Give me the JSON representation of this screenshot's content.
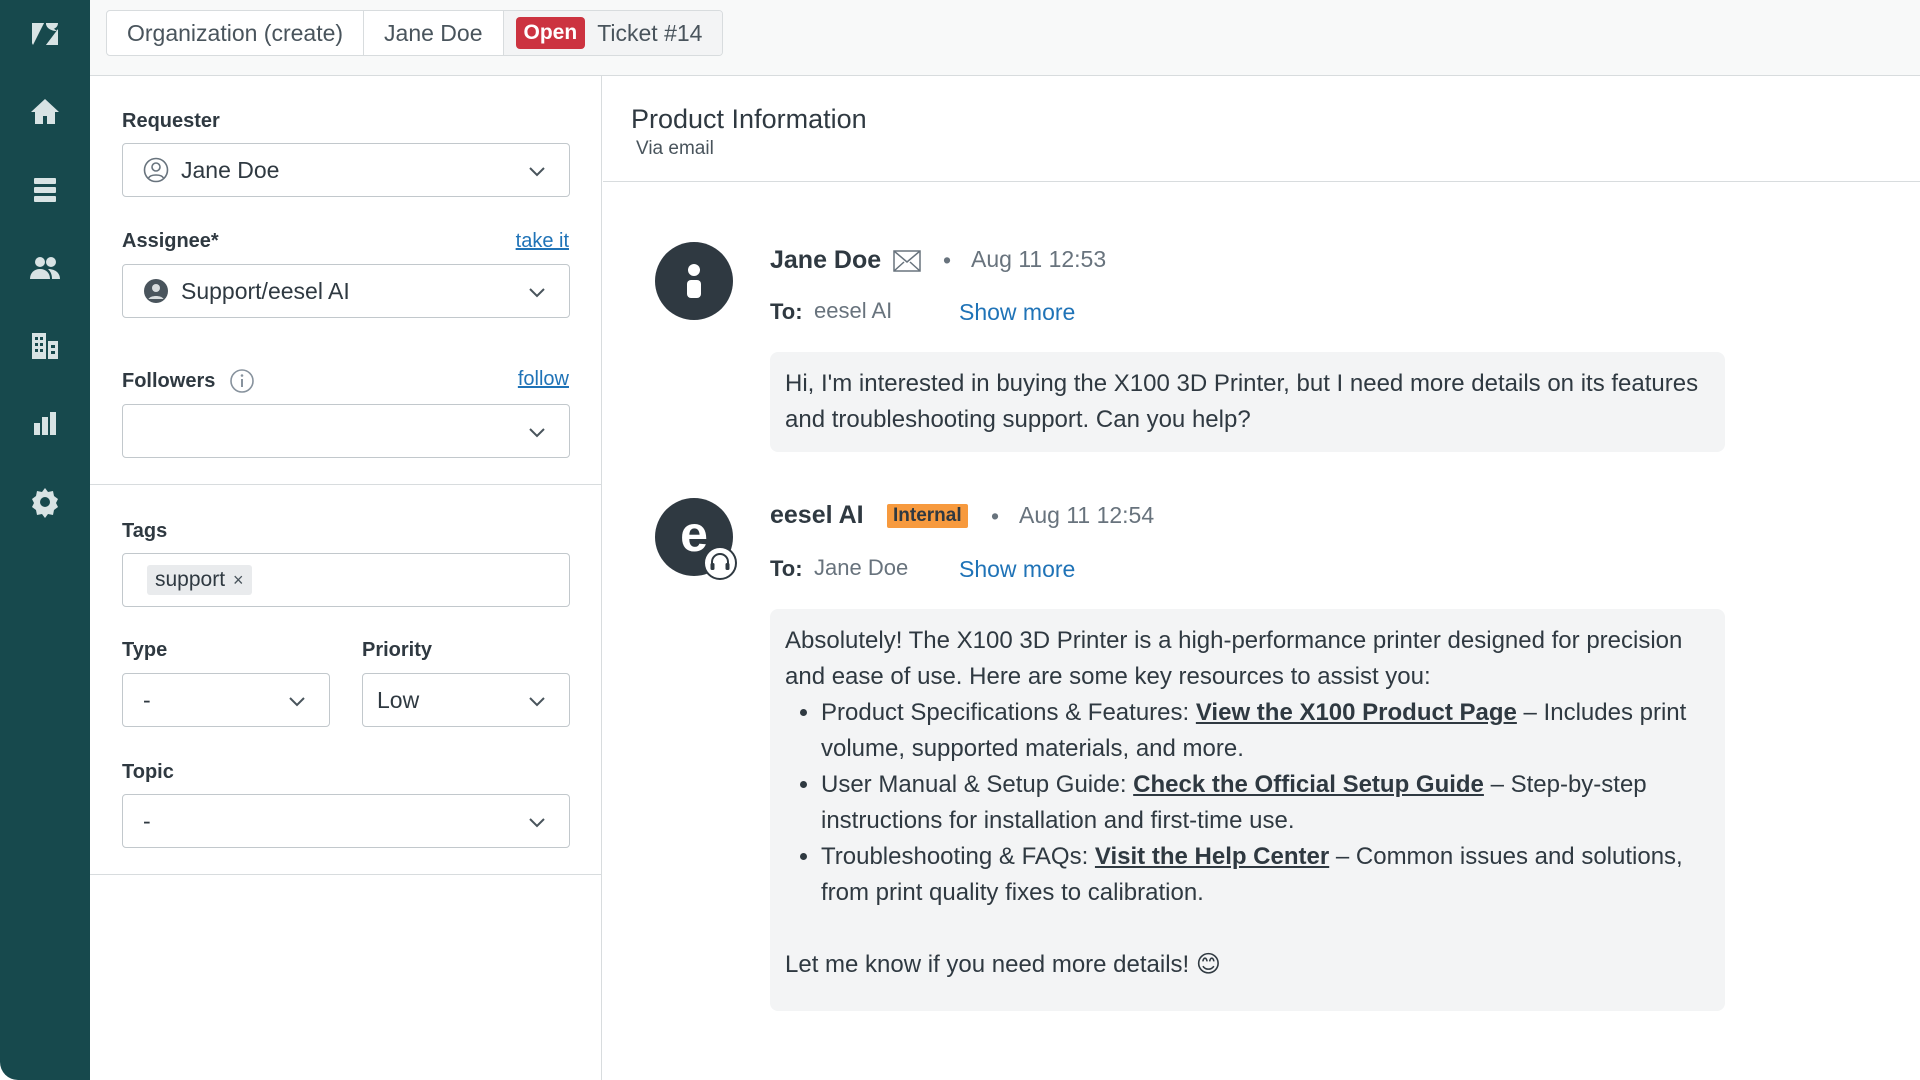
{
  "rail": {
    "icons": [
      "zendesk-logo-icon",
      "home-icon",
      "views-icon",
      "customers-icon",
      "organizations-icon",
      "reporting-icon",
      "admin-settings-icon"
    ]
  },
  "tabs": {
    "org": "Organization (create)",
    "user": "Jane Doe",
    "status": "Open",
    "ticket": "Ticket #14"
  },
  "props": {
    "requester_label": "Requester",
    "requester_value": "Jane Doe",
    "assignee_label": "Assignee*",
    "take_it": "take it",
    "assignee_value": "Support/eesel AI",
    "followers_label": "Followers",
    "follow": "follow",
    "tags_label": "Tags",
    "tag": "support",
    "tag_remove": "×",
    "type_label": "Type",
    "type_value": "-",
    "priority_label": "Priority",
    "priority_value": "Low",
    "topic_label": "Topic",
    "topic_value": "-"
  },
  "conversation": {
    "title": "Product Information",
    "channel": "Via email",
    "messages": [
      {
        "sender": "Jane Doe",
        "separator": "•",
        "time": "Aug 11 12:53",
        "to_label": "To:",
        "to": "eesel AI",
        "show_more": "Show more",
        "body": "Hi, I'm interested in buying the X100 3D Printer, but I need more details on its features and troubleshooting support. Can you help?"
      },
      {
        "sender": "eesel AI",
        "avatar_letter": "e",
        "badge": "Internal",
        "separator": "•",
        "time": "Aug 11 12:54",
        "to_label": "To:",
        "to": "Jane Doe",
        "show_more": "Show more",
        "intro": "Absolutely! The X100 3D Printer is a high-performance printer designed for precision and ease of use. Here are some key resources to assist you:",
        "items": [
          {
            "prefix": "Product Specifications & Features: ",
            "link": "View the X100 Product Page",
            "suffix": " – Includes print volume, supported materials, and more."
          },
          {
            "prefix": "User Manual & Setup Guide: ",
            "link": "Check the Official Setup Guide",
            "suffix": " – Step-by-step instructions for installation and first-time use."
          },
          {
            "prefix": "Troubleshooting & FAQs: ",
            "link": "Visit the Help Center",
            "suffix": " – Common issues and solutions, from print quality fixes to calibration."
          }
        ],
        "closing": "Let me know if you need more details! 😊"
      }
    ]
  }
}
